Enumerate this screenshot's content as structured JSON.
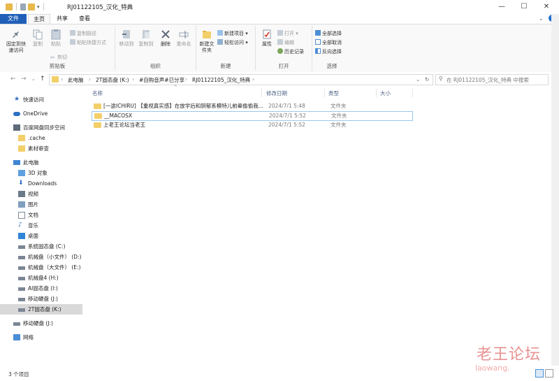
{
  "window": {
    "title": "RJ01122105_汉化_特典",
    "controls": {
      "minimize": "—",
      "maximize": "☐",
      "close": "✕"
    }
  },
  "ribbon_tabs": {
    "file": "文件",
    "home": "主页",
    "share": "共享",
    "view": "查看"
  },
  "ribbon": {
    "clipboard": {
      "pin": "固定到快速访问",
      "copy": "复制",
      "paste": "粘贴",
      "copy_path": "复制路径",
      "paste_shortcut": "粘贴快捷方式",
      "cut": "剪切",
      "label": "剪贴板"
    },
    "organize": {
      "move_to": "移动到",
      "copy_to": "复制到",
      "delete": "删除",
      "rename": "重命名",
      "label": "组织"
    },
    "new": {
      "new_folder": "新建文件夹",
      "new_item": "新建项目",
      "easy_access": "轻松访问",
      "label": "新建"
    },
    "open": {
      "properties": "属性",
      "open": "打开",
      "edit": "编辑",
      "history": "历史记录",
      "label": "打开"
    },
    "select": {
      "select_all": "全部选择",
      "select_none": "全部取消",
      "invert": "反向选择",
      "label": "选择"
    }
  },
  "address": {
    "crumbs": [
      "此电脑",
      "2T固态盘 (K:)",
      "#自购音声#已分享",
      "RJ01122105_汉化_特典"
    ],
    "search_placeholder": "在 RJ01122105_汉化_特典 中搜索"
  },
  "nav": {
    "quick_access": "快速访问",
    "onedrive": "OneDrive",
    "baidu": "百度网盘同步空间",
    "cache": ".cache",
    "material": "素材审查",
    "this_pc": "此电脑",
    "objects3d": "3D 对象",
    "downloads": "Downloads",
    "videos": "视频",
    "pictures": "图片",
    "documents": "文档",
    "music": "音乐",
    "desktop": "桌面",
    "drive_c": "系统固态盘 (C:)",
    "drive_d": "机械盘（小文件） (D:)",
    "drive_e": "机械盘（大文件） (E:)",
    "drive_h": "机械盘4 (H:)",
    "drive_i": "AI固态盘 (I:)",
    "drive_j": "移动硬盘 (J:)",
    "drive_k": "2T固态盘 (K:)",
    "drive_j2": "移动硬盘 (J:)",
    "network": "网络"
  },
  "columns": {
    "name": "名称",
    "date": "修改日期",
    "type": "类型",
    "size": "大小"
  },
  "files": [
    {
      "name": "[一途ICHIRU] 【重视真实感】在放学后和阴郁系模特儿前辈偷偷我...",
      "date": "2024/7/1 5:48",
      "type": "文件夹"
    },
    {
      "name": "__MACOSX",
      "date": "2024/7/1 5:52",
      "type": "文件夹"
    },
    {
      "name": "上老王论坛当老王",
      "date": "2024/7/1 5:52",
      "type": "文件夹"
    }
  ],
  "status": {
    "count": "3 个项目"
  },
  "watermark": {
    "main": "老王论坛",
    "sub": "laowang."
  },
  "colors": {
    "accent": "#1f5fb8",
    "folder": "#f3cf6a",
    "selected": "#d9d9d9"
  }
}
